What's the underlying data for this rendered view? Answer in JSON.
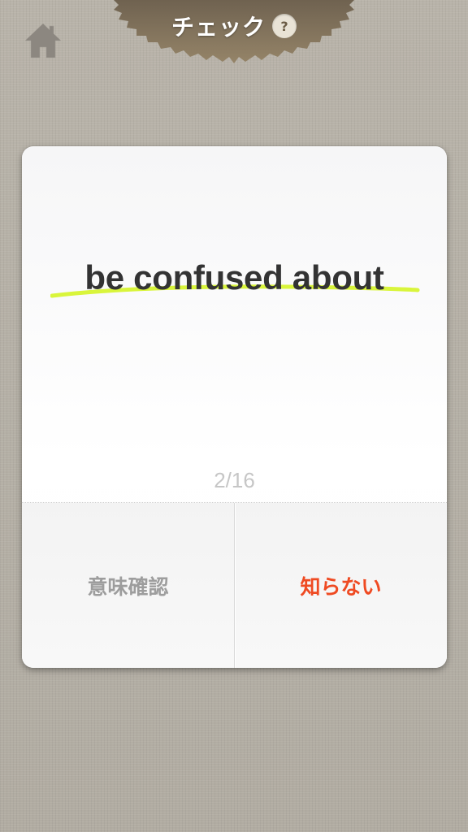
{
  "header": {
    "title": "チェック",
    "help_label": "?"
  },
  "icons": {
    "home": "home-icon"
  },
  "colors": {
    "background": "#b5b0a6",
    "header_badge": "#8a7a5f",
    "highlight": "#d9f53b",
    "word": "#333333",
    "progress": "#c6c6c6",
    "left_action": "#9d9d9d",
    "right_action": "#ef4a22"
  },
  "card": {
    "word": "be confused about",
    "progress": "2/16",
    "actions": {
      "check_meaning": "意味確認",
      "dont_know": "知らない"
    }
  }
}
